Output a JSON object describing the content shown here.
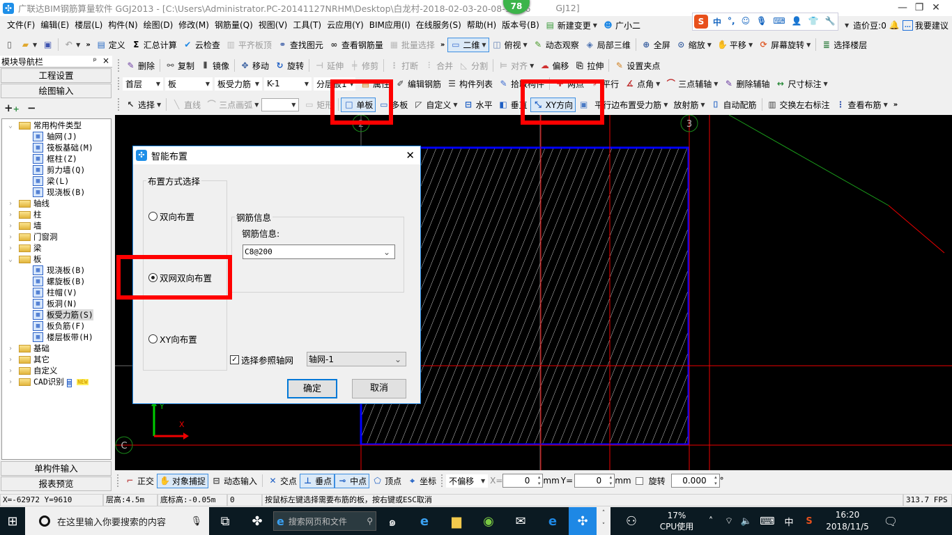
{
  "window": {
    "title_left": "广联达BIM钢筋算量软件 GGJ2013 - [C:\\Users\\Administrator.PC-20141127NRHM\\Desktop\\白龙村-2018-02-03-20-08-17(26",
    "title_right": "GJ12]",
    "badge": "78",
    "minimize": "—",
    "restore": "❐",
    "close": "✕"
  },
  "menu": [
    "文件(F)",
    "编辑(E)",
    "楼层(L)",
    "构件(N)",
    "绘图(D)",
    "修改(M)",
    "钢筋量(Q)",
    "视图(V)",
    "工具(T)",
    "云应用(Y)",
    "BIM应用(I)",
    "在线服务(S)",
    "帮助(H)",
    "版本号(B)"
  ],
  "menu_extra": {
    "new_change": "新建变更",
    "assistant": "广小二",
    "price_beans": "造价豆:0",
    "suggest": "我要建议"
  },
  "ime": {
    "logo": "S",
    "items": [
      "中",
      "°,",
      "☺",
      "🎙",
      "⌨",
      "👤",
      "👕",
      "🔧"
    ]
  },
  "toolbar_main": [
    {
      "icon": "new-file",
      "label": ""
    },
    {
      "icon": "open-folder",
      "label": "",
      "dd": true
    },
    {
      "icon": "save",
      "label": ""
    },
    {
      "sep": true
    },
    {
      "icon": "undo",
      "label": "",
      "dd": true,
      "disabled": true
    },
    {
      "icon": "overflow",
      "label": "»"
    },
    {
      "icon": "define",
      "label": "定义"
    },
    {
      "icon": "sigma",
      "label": "汇总计算"
    },
    {
      "icon": "cloud-check",
      "label": "云检查"
    },
    {
      "icon": "align-top",
      "label": "平齐板顶",
      "disabled": true
    },
    {
      "icon": "binoculars",
      "label": "查找图元"
    },
    {
      "icon": "glasses",
      "label": "查看钢筋量"
    },
    {
      "icon": "batch-select",
      "label": "批量选择",
      "disabled": true
    },
    {
      "icon": "overflow",
      "label": "»"
    },
    {
      "icon": "2d-view",
      "label": "二维",
      "dd": true,
      "active": true
    },
    {
      "icon": "top-view",
      "label": "俯视",
      "dd": true
    },
    {
      "icon": "orbit",
      "label": "动态观察"
    },
    {
      "icon": "local-3d",
      "label": "局部三维"
    },
    {
      "sep": true
    },
    {
      "icon": "fullscreen",
      "label": "全屏"
    },
    {
      "icon": "zoom",
      "label": "缩放",
      "dd": true
    },
    {
      "icon": "pan",
      "label": "平移",
      "dd": true
    },
    {
      "icon": "rotate-screen",
      "label": "屏幕旋转",
      "dd": true
    },
    {
      "sep": true
    },
    {
      "icon": "select-floor",
      "label": "选择楼层"
    }
  ],
  "toolbar_edit": [
    {
      "icon": "delete",
      "label": "删除"
    },
    {
      "sep": true
    },
    {
      "icon": "copy",
      "label": "复制"
    },
    {
      "icon": "mirror",
      "label": "镜像"
    },
    {
      "sep": true
    },
    {
      "icon": "move",
      "label": "移动"
    },
    {
      "icon": "rotate",
      "label": "旋转"
    },
    {
      "sep": true
    },
    {
      "icon": "extend",
      "label": "延伸",
      "disabled": true
    },
    {
      "icon": "trim",
      "label": "修剪",
      "disabled": true
    },
    {
      "sep": true
    },
    {
      "icon": "break",
      "label": "打断",
      "disabled": true
    },
    {
      "icon": "merge",
      "label": "合并",
      "disabled": true
    },
    {
      "icon": "split",
      "label": "分割",
      "disabled": true
    },
    {
      "sep": true
    },
    {
      "icon": "align",
      "label": "对齐",
      "dd": true,
      "disabled": true
    },
    {
      "icon": "offset",
      "label": "偏移"
    },
    {
      "icon": "stretch",
      "label": "拉伸"
    },
    {
      "sep": true
    },
    {
      "icon": "grip-point",
      "label": "设置夹点"
    }
  ],
  "selectors": {
    "floor": "首层",
    "type": "板",
    "subtype": "板受力筋",
    "name": "K-1",
    "layer": "分层板1"
  },
  "toolbar_comp": [
    {
      "icon": "properties",
      "label": "属性"
    },
    {
      "icon": "edit-rebar",
      "label": "编辑钢筋"
    },
    {
      "icon": "component-list",
      "label": "构件列表"
    },
    {
      "icon": "pick",
      "label": "拾取构件"
    },
    {
      "sep": true
    },
    {
      "icon": "two-point",
      "label": "两点"
    },
    {
      "icon": "parallel",
      "label": "平行"
    },
    {
      "icon": "point-angle",
      "label": "点角",
      "dd": true
    },
    {
      "icon": "three-point-axis",
      "label": "三点辅轴",
      "dd": true
    },
    {
      "icon": "delete-axis",
      "label": "删除辅轴"
    },
    {
      "icon": "dimension",
      "label": "尺寸标注",
      "dd": true
    }
  ],
  "toolbar_draw": [
    {
      "icon": "cursor",
      "label": "选择",
      "dd": true
    },
    {
      "sep": true
    },
    {
      "icon": "line",
      "label": "直线",
      "disabled": true
    },
    {
      "icon": "arc",
      "label": "三点画弧",
      "dd": true,
      "disabled": true
    },
    {
      "select": true,
      "label": ""
    },
    {
      "icon": "rectangle",
      "label": "矩形",
      "disabled": true
    },
    {
      "sep": true
    },
    {
      "icon": "single-slab",
      "label": "单板",
      "active": true
    },
    {
      "icon": "multi-slab",
      "label": "多板"
    },
    {
      "icon": "custom",
      "label": "自定义",
      "dd": true
    },
    {
      "icon": "horizontal",
      "label": "水平"
    },
    {
      "icon": "vertical",
      "label": "垂直"
    },
    {
      "icon": "xy-direction",
      "label": "XY方向",
      "active": true
    },
    {
      "icon": "smart-layout",
      "label": ""
    },
    {
      "icon": "parallel-edge",
      "label": "平行边布置受力筋",
      "dd": true
    },
    {
      "icon": "radial",
      "label": "放射筋",
      "dd": true
    },
    {
      "icon": "auto-rebar",
      "label": "自动配筋"
    },
    {
      "sep": true
    },
    {
      "icon": "swap-labels",
      "label": "交换左右标注"
    },
    {
      "icon": "view-rebar",
      "label": "查看布筋",
      "dd": true
    },
    {
      "icon": "overflow",
      "label": "»"
    }
  ],
  "nav": {
    "title": "模块导航栏",
    "pin": "ᵖ",
    "close": "×",
    "project_settings": "工程设置",
    "drawing_input": "绘图输入",
    "expand_all": "+",
    "collapse_all": "−",
    "single_input": "单构件输入",
    "report_preview": "报表预览",
    "tree": [
      {
        "label": "常用构件类型",
        "folder": true,
        "open": true
      },
      {
        "label": "轴网(J)",
        "icon": "grid",
        "child": true
      },
      {
        "label": "筏板基础(M)",
        "icon": "raft",
        "child": true
      },
      {
        "label": "框柱(Z)",
        "icon": "column",
        "child": true
      },
      {
        "label": "剪力墙(Q)",
        "icon": "shear-wall",
        "child": true
      },
      {
        "label": "梁(L)",
        "icon": "beam",
        "child": true
      },
      {
        "label": "现浇板(B)",
        "icon": "slab",
        "child": true
      },
      {
        "label": "轴线",
        "folder": true
      },
      {
        "label": "柱",
        "folder": true
      },
      {
        "label": "墙",
        "folder": true
      },
      {
        "label": "门窗洞",
        "folder": true
      },
      {
        "label": "梁",
        "folder": true
      },
      {
        "label": "板",
        "folder": true,
        "open": true
      },
      {
        "label": "现浇板(B)",
        "icon": "slab",
        "child": true
      },
      {
        "label": "螺旋板(B)",
        "icon": "spiral-slab",
        "child": true
      },
      {
        "label": "柱帽(V)",
        "icon": "column-cap",
        "child": true
      },
      {
        "label": "板洞(N)",
        "icon": "slab-hole",
        "child": true
      },
      {
        "label": "板受力筋(S)",
        "icon": "slab-rebar",
        "child": true,
        "selected": true
      },
      {
        "label": "板负筋(F)",
        "icon": "negative-rebar",
        "child": true
      },
      {
        "label": "楼层板带(H)",
        "icon": "slab-strip",
        "child": true
      },
      {
        "label": "基础",
        "folder": true
      },
      {
        "label": "其它",
        "folder": true
      },
      {
        "label": "自定义",
        "folder": true
      },
      {
        "label": "CAD识别",
        "folder": true,
        "new": "NEW"
      }
    ]
  },
  "canvas": {
    "axis_labels": {
      "axis_2": "2",
      "axis_3": "3",
      "axis_c": "C"
    },
    "ucs": {
      "x": "X",
      "y": "Y"
    }
  },
  "dialog": {
    "title": "智能布置",
    "close": "✕",
    "group_mode": "布置方式选择",
    "options": [
      {
        "label": "双向布置",
        "checked": false
      },
      {
        "label": "双网双向布置",
        "checked": true
      },
      {
        "label": "XY向布置",
        "checked": false
      }
    ],
    "group_rebar": "钢筋信息",
    "rebar_label": "钢筋信息:",
    "rebar_value": "C8@200",
    "ref_grid_label": "选择参照轴网",
    "ref_grid_checked": true,
    "ref_grid_value": "轴网-1",
    "ok": "确定",
    "cancel": "取消"
  },
  "bottom_toolbar": {
    "items": [
      {
        "icon": "ortho",
        "label": "正交"
      },
      {
        "icon": "object-snap",
        "label": "对象捕捉",
        "active": true
      },
      {
        "icon": "dynamic-input",
        "label": "动态输入"
      },
      {
        "sep": true
      },
      {
        "icon": "intersection",
        "label": "交点"
      },
      {
        "icon": "perpendicular",
        "label": "垂点",
        "active": true
      },
      {
        "icon": "midpoint",
        "label": "中点",
        "active": true
      },
      {
        "icon": "vertex",
        "label": "顶点"
      },
      {
        "icon": "coordinate",
        "label": "坐标"
      }
    ],
    "offset": "不偏移",
    "x_label": "X=",
    "x_value": "0",
    "mm1": "mm",
    "y_label": "Y=",
    "y_value": "0",
    "mm2": "mm",
    "rotate_label": "旋转",
    "rotate_value": "0.000",
    "degree": "°"
  },
  "status": {
    "coords": "X=-62972 Y=9610",
    "floor_height": "层高:4.5m",
    "bottom_elev": "底标高:-0.05m",
    "value": "0",
    "hint": "按鼠标左键选择需要布筋的板，按右键或ESC取消",
    "fps": "313.7 FPS"
  },
  "taskbar": {
    "search_placeholder": "在这里输入你要搜索的内容",
    "web_search": "搜索网页和文件",
    "cpu_percent": "17%",
    "cpu_label": "CPU使用",
    "ime": "中",
    "time": "16:20",
    "date": "2018/11/5"
  }
}
